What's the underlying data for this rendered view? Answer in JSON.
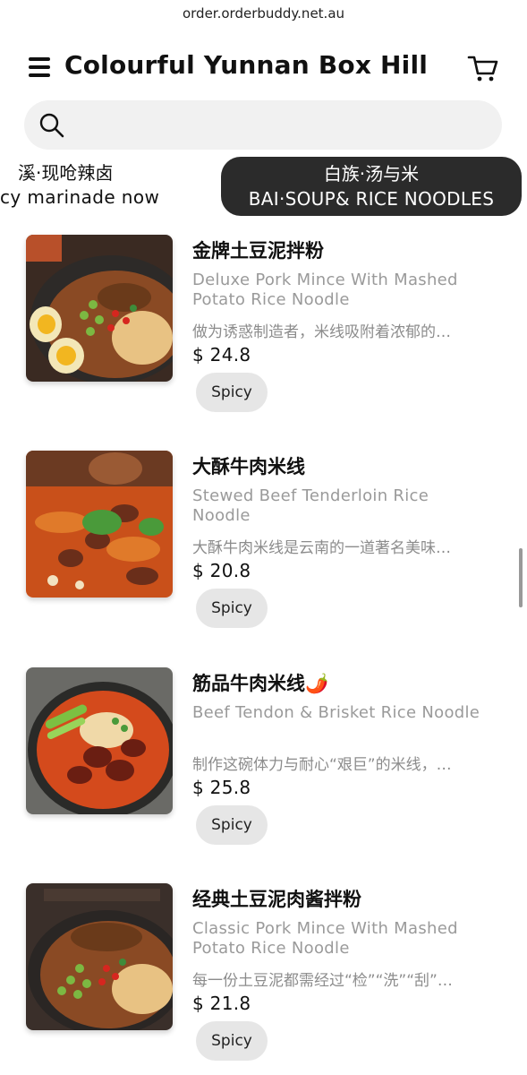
{
  "browser": {
    "url": "order.orderbuddy.net.au"
  },
  "header": {
    "title": "Colourful Yunnan Box Hill",
    "menu_icon": "hamburger-menu-icon",
    "cart_icon": "shopping-cart-icon"
  },
  "search": {
    "icon": "search-icon",
    "placeholder": "",
    "value": ""
  },
  "categories": {
    "previous": {
      "zh": "溪·现呛辣卤",
      "en": "cy marinade now"
    },
    "active": {
      "zh": "白族·汤与米",
      "en": "BAI·SOUP& RICE NOODLES"
    }
  },
  "items": [
    {
      "name_zh": "金牌土豆泥拌粉",
      "name_en": "Deluxe Pork Mince With Mashed Potato Rice Noodle",
      "desc": "做为诱惑制造者，米线吸附着浓郁的…",
      "price": "$ 24.8",
      "tag": "Spicy"
    },
    {
      "name_zh": "大酥牛肉米线",
      "name_en": "Stewed Beef Tenderloin Rice Noodle",
      "desc": "大酥牛肉米线是云南的一道著名美味…",
      "price": "$ 20.8",
      "tag": "Spicy"
    },
    {
      "name_zh": "筋品牛肉米线🌶️",
      "name_en": "Beef Tendon & Brisket Rice Noodle",
      "desc": "制作这碗体力与耐心“艰巨”的米线，…",
      "price": "$ 25.8",
      "tag": "Spicy"
    },
    {
      "name_zh": "经典土豆泥肉酱拌粉",
      "name_en": "Classic Pork Mince With Mashed Potato Rice Noodle",
      "desc": "每一份土豆泥都需经过“检”“洗”“刮”…",
      "price": "$ 21.8",
      "tag": "Spicy"
    }
  ]
}
